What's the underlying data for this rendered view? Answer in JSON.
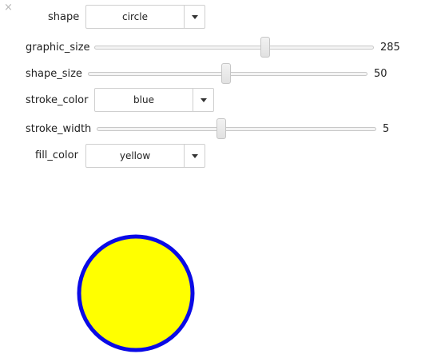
{
  "close_glyph": "×",
  "controls": {
    "shape": {
      "label": "shape",
      "value": "circle"
    },
    "graphic_size": {
      "label": "graphic_size",
      "value": "285",
      "min": 0,
      "max": 500
    },
    "shape_size": {
      "label": "shape_size",
      "value": "50",
      "min": 0,
      "max": 100
    },
    "stroke_color": {
      "label": "stroke_color",
      "value": "blue"
    },
    "stroke_width": {
      "label": "stroke_width",
      "value": "5",
      "min": 0,
      "max": 10
    },
    "fill_color": {
      "label": "fill_color",
      "value": "yellow"
    }
  },
  "output": {
    "shape": "circle",
    "stroke": "#0a0ae6",
    "fill": "#ffff00"
  }
}
